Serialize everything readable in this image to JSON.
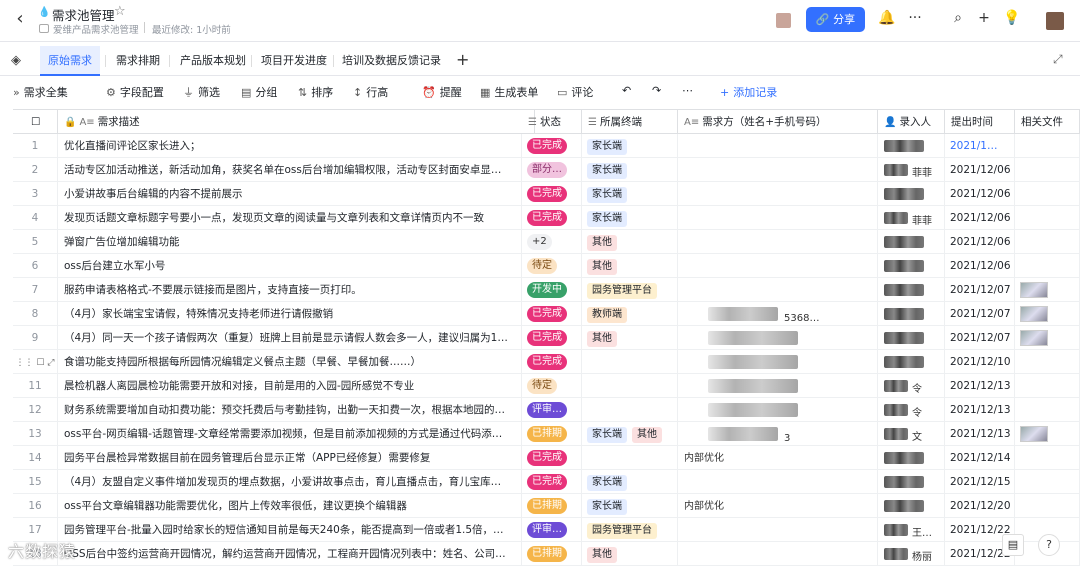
{
  "header": {
    "title": "需求池管理",
    "breadcrumb": "爱维产品需求池管理",
    "modified": "最近修改: 1小时前",
    "share_label": "分享"
  },
  "tabs": [
    "原始需求",
    "需求排期",
    "产品版本规划",
    "项目开发进度",
    "培训及数据反馈记录"
  ],
  "toolbar": {
    "view_all": "需求全集",
    "field_config": "字段配置",
    "filter": "筛选",
    "group": "分组",
    "sort": "排序",
    "row_height": "行高",
    "remind": "提醒",
    "form": "生成表单",
    "comment": "评论",
    "add_record": "添加记录"
  },
  "columns": {
    "desc": "需求描述",
    "status": "状态",
    "terminal": "所属终端",
    "requester": "需求方（姓名+手机号码）",
    "creator": "录入人",
    "time": "提出时间",
    "files": "相关文件"
  },
  "rows": [
    {
      "idx": "1",
      "desc": "优化直播间评论区家长进入；",
      "status": "已完成",
      "terminals": [
        "家长端"
      ],
      "requester": "",
      "creator": "",
      "time": "2021/1…",
      "link": true,
      "thumb": false
    },
    {
      "idx": "2",
      "desc": "活动专区加活动推送，新活动加角，获奖名单在oss后台增加编辑权限，活动专区封面安卓显…",
      "status": "部分…",
      "terminals": [
        "家长端"
      ],
      "requester": "",
      "creator": "菲菲",
      "time": "2021/12/06",
      "link": false,
      "thumb": false
    },
    {
      "idx": "3",
      "desc": "小爱讲故事后台编辑的内容不提前展示",
      "status": "已完成",
      "terminals": [
        "家长端"
      ],
      "requester": "",
      "creator": "",
      "time": "2021/12/06",
      "link": false,
      "thumb": false
    },
    {
      "idx": "4",
      "desc": "发现页话题文章标题字号要小一点，发现页文章的阅读量与文章列表和文章详情页内不一致",
      "status": "已完成",
      "terminals": [
        "家长端"
      ],
      "requester": "",
      "creator": "菲菲",
      "time": "2021/12/06",
      "link": false,
      "thumb": false
    },
    {
      "idx": "5",
      "desc": "弹窗广告位增加编辑功能",
      "status": "+2",
      "terminals": [
        "其他"
      ],
      "requester": "",
      "creator": "",
      "time": "2021/12/06",
      "link": false,
      "thumb": false
    },
    {
      "idx": "6",
      "desc": "oss后台建立水军小号",
      "status": "待定",
      "terminals": [
        "其他"
      ],
      "requester": "",
      "creator": "",
      "time": "2021/12/06",
      "link": false,
      "thumb": false
    },
    {
      "idx": "7",
      "desc": "服药申请表格格式-不要展示链接而是图片，支持直接一页打印。",
      "status": "开发中",
      "terminals": [
        "园务管理平台"
      ],
      "requester": "",
      "creator": "",
      "time": "2021/12/07",
      "link": false,
      "thumb": true
    },
    {
      "idx": "8",
      "desc": "（4月）家长端宝宝请假，特殊情况支持老师进行请假撤销",
      "status": "已完成",
      "terminals": [
        "教师端"
      ],
      "requester": "5368…",
      "creator": "",
      "time": "2021/12/07",
      "link": false,
      "thumb": true
    },
    {
      "idx": "9",
      "desc": "（4月）同一天一个孩子请假两次（重复）班牌上目前是显示请假人数会多一人，建议归属为1…",
      "status": "已完成",
      "terminals": [
        "其他"
      ],
      "requester": "",
      "creator": "",
      "time": "2021/12/07",
      "link": false,
      "thumb": true
    },
    {
      "idx": "",
      "desc": "食谱功能支持园所根据每所园情况编辑定义餐点主题（早餐、早餐加餐……）",
      "status": "已完成",
      "terminals": [],
      "requester": "",
      "creator": "",
      "time": "2021/12/10",
      "link": false,
      "thumb": false
    },
    {
      "idx": "11",
      "desc": "晨检机器人离园晨检功能需要开放和对接，目前是用的入园-园所感觉不专业",
      "status": "待定",
      "terminals": [],
      "requester": "",
      "creator": "令",
      "time": "2021/12/13",
      "link": false,
      "thumb": false
    },
    {
      "idx": "12",
      "desc": "财务系统需要增加自动扣费功能：预交托费后与考勤挂钩，出勤一天扣费一次，根据本地园的…",
      "status": "评审…",
      "terminals": [],
      "requester": "",
      "creator": "令",
      "time": "2021/12/13",
      "link": false,
      "thumb": false
    },
    {
      "idx": "13",
      "desc": "oss平台-网页编辑-话题管理-文章经常需要添加视频，但是目前添加视频的方式是通过代码添…",
      "status": "已排期",
      "terminals": [
        "家长端",
        "其他"
      ],
      "requester": "3",
      "creator": "文",
      "time": "2021/12/13",
      "link": false,
      "thumb": true
    },
    {
      "idx": "14",
      "desc": "园务平台晨检异常数据目前在园务管理后台显示正常（APP已经修复）需要修复",
      "status": "已完成",
      "terminals": [],
      "requester": "内部优化",
      "creator": "",
      "time": "2021/12/14",
      "link": false,
      "thumb": false
    },
    {
      "idx": "15",
      "desc": "（4月）友盟自定义事件增加发现页的埋点数据，小爱讲故事点击，育儿直播点击，育儿宝库…",
      "status": "已完成",
      "terminals": [
        "家长端"
      ],
      "requester": "",
      "creator": "",
      "time": "2021/12/15",
      "link": false,
      "thumb": false
    },
    {
      "idx": "16",
      "desc": "oss平台文章编辑器功能需要优化，图片上传效率很低，建议更换个编辑器",
      "status": "已排期",
      "terminals": [
        "家长端"
      ],
      "requester": "内部优化",
      "creator": "",
      "time": "2021/12/20",
      "link": false,
      "thumb": false
    },
    {
      "idx": "17",
      "desc": "园务管理平台-批量入园时给家长的短信通知目前是每天240条，能否提高到一倍或者1.5倍，…",
      "status": "评审…",
      "terminals": [
        "园务管理平台"
      ],
      "requester": "",
      "creator": "王…",
      "time": "2021/12/22",
      "link": false,
      "thumb": false
    },
    {
      "idx": "18",
      "desc": "OSS后台中签约运营商开园情况，解约运营商开园情况，工程商开园情况列表中：姓名、公司…",
      "status": "已排期",
      "terminals": [
        "其他"
      ],
      "requester": "",
      "creator": "杨丽",
      "time": "2021/12/22",
      "link": false,
      "thumb": false
    }
  ],
  "watermark": "六数探猿",
  "colors": {
    "accent": "#3370ff",
    "done_bg": "#e8327a",
    "partial_bg": "#f1c3de",
    "pending_bg": "#fbe3c4",
    "developing_bg": "#38a169",
    "review_bg": "#6d4cd6",
    "scheduled_bg": "#f5b54a"
  }
}
